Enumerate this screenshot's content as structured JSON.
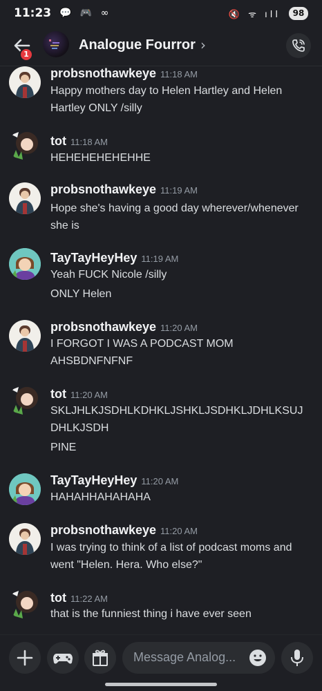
{
  "status_bar": {
    "time": "11:23",
    "left_icons": "💬 🎮 ∞",
    "right_icons": "🔇 ᯤ ıll",
    "battery": "98"
  },
  "header": {
    "channel_name": "Analogue Fourror",
    "badge_count": "1"
  },
  "messages": [
    {
      "author": "probsnothawkeye",
      "time": "11:18 AM",
      "lines": [
        "Happy mothers day to Helen Hartley and Helen",
        "Hartley ONLY /silly"
      ]
    },
    {
      "author": "tot",
      "time": "11:18 AM",
      "lines": [
        "HEHEHEHEHEHHE"
      ]
    },
    {
      "author": "probsnothawkeye",
      "time": "11:19 AM",
      "lines": [
        "Hope she's having a good day wherever/whenever",
        "she is"
      ]
    },
    {
      "author": "TayTayHeyHey",
      "time": "11:19 AM",
      "lines": [
        "Yeah FUCK Nicole /silly",
        "ONLY Helen"
      ]
    },
    {
      "author": "probsnothawkeye",
      "time": "11:20 AM",
      "lines": [
        "I FORGOT I WAS A PODCAST MOM",
        "AHSBDNFNFNF"
      ]
    },
    {
      "author": "tot",
      "time": "11:20 AM",
      "lines": [
        "SKLJHLKJSDHLKDHKLJSHKLJSDHKLJDHLKSUJ",
        "DHLKJSDH",
        "PINE"
      ]
    },
    {
      "author": "TayTayHeyHey",
      "time": "11:20 AM",
      "lines": [
        "HAHAHHAHAHAHA"
      ]
    },
    {
      "author": "probsnothawkeye",
      "time": "11:20 AM",
      "lines": [
        "I was trying to think of a list of podcast moms and",
        "went \"Helen. Hera. Who else?\""
      ]
    },
    {
      "author": "tot",
      "time": "11:22 AM",
      "lines": [
        "that is the funniest thing i have ever seen"
      ]
    }
  ],
  "composer": {
    "placeholder": "Message Analog..."
  },
  "colors": {
    "background": "#1e1f24",
    "panel": "#2b2d31",
    "badge": "#e7393f",
    "timestamp": "#949ba4"
  },
  "icons": [
    "back-arrow-icon",
    "chevron-right-icon",
    "phone-icon",
    "plus-icon",
    "gamepad-icon",
    "gift-icon",
    "emoji-icon",
    "microphone-icon"
  ]
}
